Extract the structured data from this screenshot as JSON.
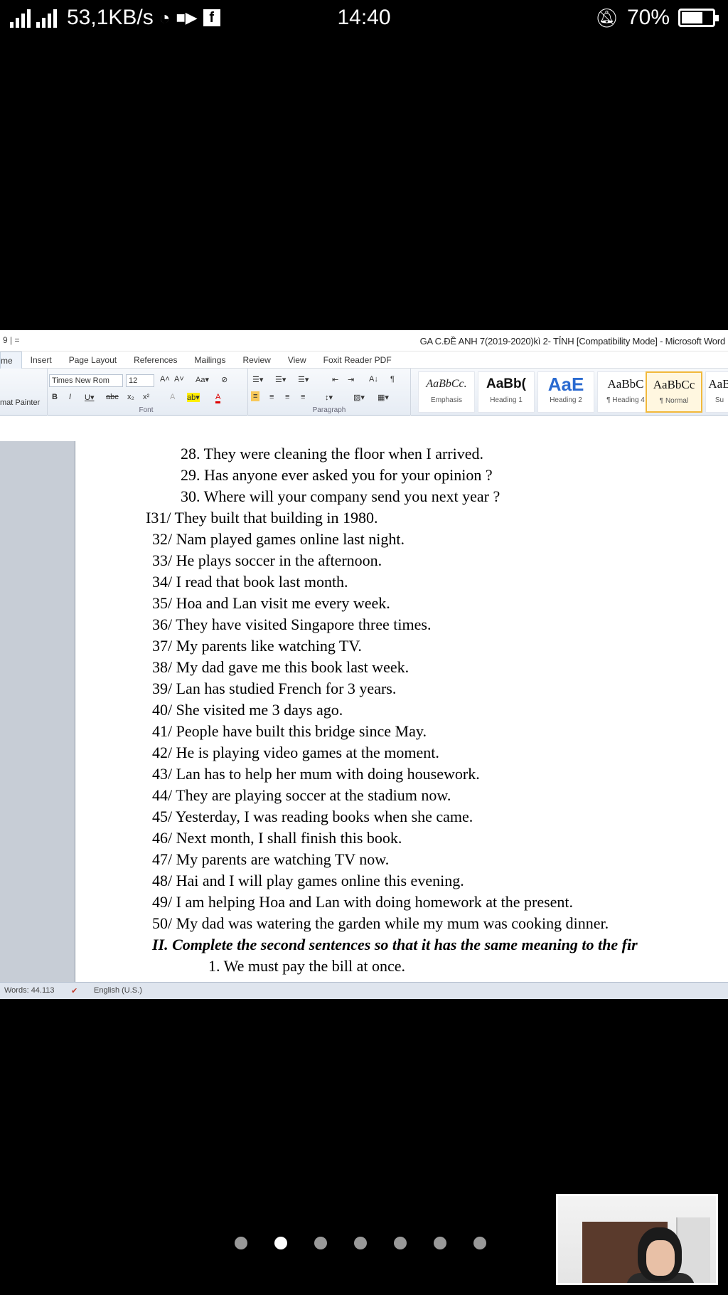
{
  "status_bar": {
    "network_speed": "53,1KB/s",
    "time": "14:40",
    "battery": "70%",
    "battery_level": 0.7
  },
  "word": {
    "quick_access": "9 | =",
    "title": "GA C.ĐỀ ANH 7(2019-2020)kì 2- TỈNH [Compatibility Mode] - Microsoft Word",
    "tabs": [
      {
        "label": "me"
      },
      {
        "label": "Insert"
      },
      {
        "label": "Page Layout"
      },
      {
        "label": "References"
      },
      {
        "label": "Mailings"
      },
      {
        "label": "Review"
      },
      {
        "label": "View"
      },
      {
        "label": "Foxit Reader PDF"
      }
    ],
    "ribbon": {
      "format_painter": "mat Painter",
      "font_name": "Times New Rom",
      "font_size": "12",
      "font_group": "Font",
      "paragraph_group": "Paragraph",
      "styles": [
        {
          "sample": "AaBbCc.",
          "name": "Emphasis"
        },
        {
          "sample": "AaBb(",
          "name": "Heading 1"
        },
        {
          "sample": "AaE",
          "name": "Heading 2"
        },
        {
          "sample": "AaBbC",
          "name": "¶ Heading 4"
        },
        {
          "sample": "AaBbCc",
          "name": "¶ Normal"
        },
        {
          "sample": "AaB",
          "name": "Su"
        }
      ]
    },
    "document": {
      "lines_a": [
        "28. They were cleaning the floor when I arrived.",
        "29. Has anyone ever asked you for your opinion ?",
        "30. Where will your company send you next year ?"
      ],
      "lines_b": [
        "I31/ They built that building in 1980.",
        "32/ Nam played games online last night.",
        "33/ He plays soccer in the afternoon.",
        "34/ I read that book last month.",
        "35/ Hoa and Lan visit me every week.",
        "36/ They have visited Singapore three times.",
        "37/ My parents like watching TV.",
        "38/ My dad gave me this book last week.",
        "39/ Lan has studied French for 3 years.",
        "40/ She visited me 3 days ago.",
        "41/ People have built this bridge since May.",
        "42/ He is playing video games at the moment.",
        "43/ Lan has to help her mum with doing housework.",
        "44/ They are playing soccer at the stadium now.",
        "45/ Yesterday, I was reading books when she came.",
        "46/ Next month, I shall finish this book.",
        "47/ My parents are watching TV now.",
        "48/ Hai and I will play games online this evening.",
        "49/ I am helping Hoa and Lan with doing homework  at the present.",
        "50/ My dad was watering the garden while my mum was cooking dinner."
      ],
      "heading": "II. Complete the second sentences so that it has the same meaning to the fir",
      "last_line": "1. We must pay the bill at once."
    },
    "status": {
      "words": "Words: 44.113",
      "language": "English (U.S.)"
    }
  },
  "pager": {
    "count": 7,
    "active_index": 1
  }
}
